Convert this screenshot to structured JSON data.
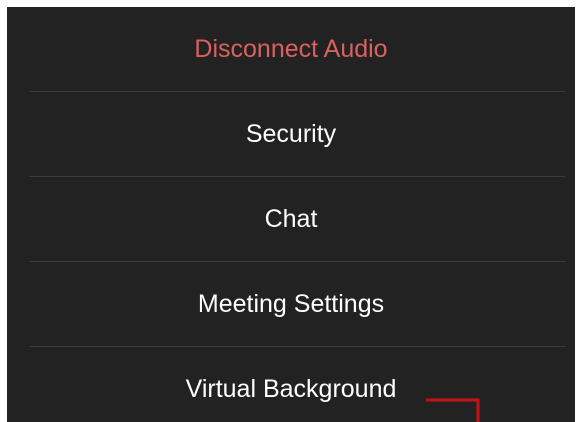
{
  "menu": {
    "items": [
      {
        "label": "Disconnect Audio"
      },
      {
        "label": "Security"
      },
      {
        "label": "Chat"
      },
      {
        "label": "Meeting Settings"
      },
      {
        "label": "Virtual Background"
      }
    ]
  },
  "colors": {
    "background": "#222222",
    "danger_text": "#d9625f",
    "text": "#ffffff",
    "divider": "#3d3d3d",
    "callout": "#c8101a"
  }
}
